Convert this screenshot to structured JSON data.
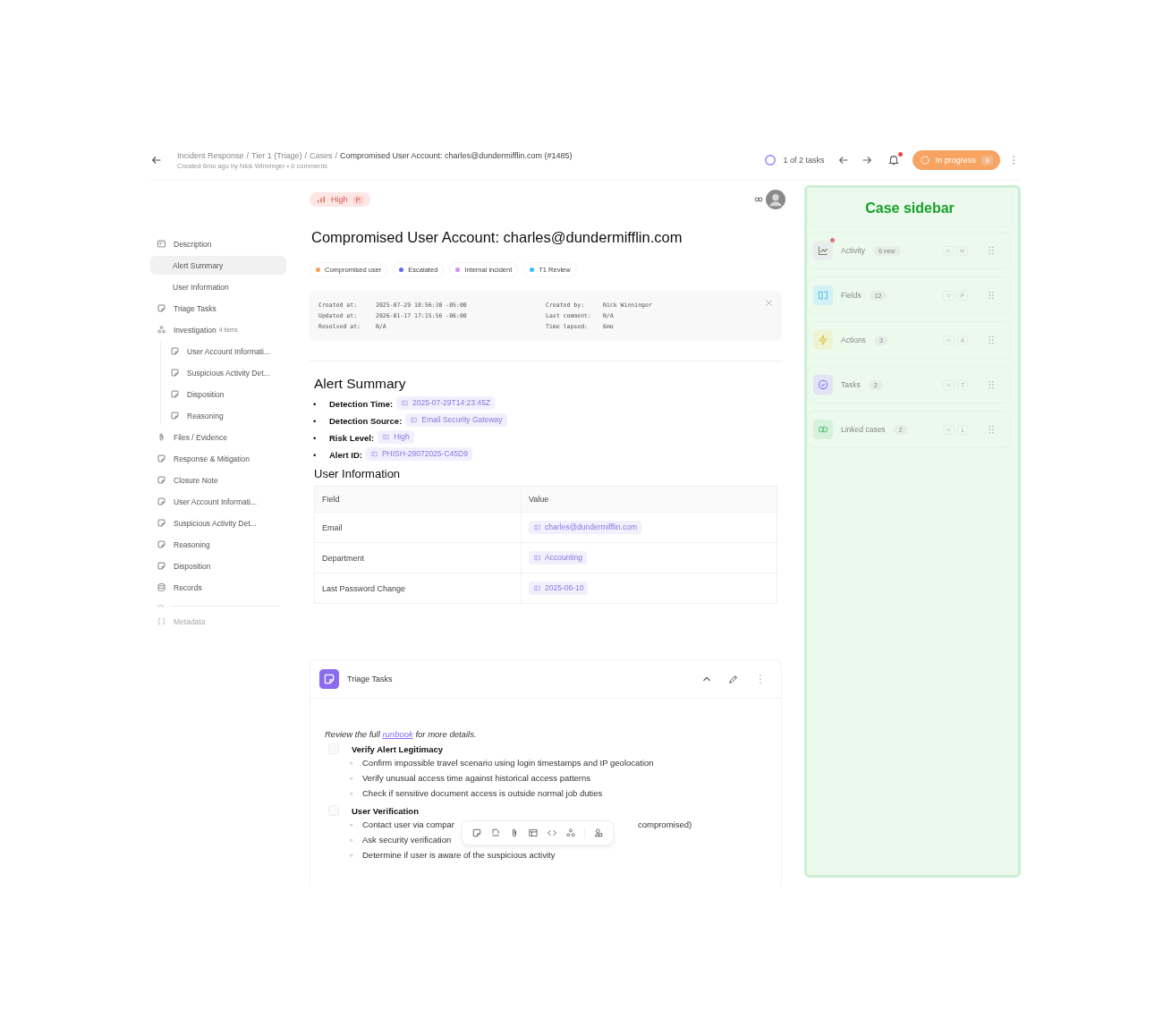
{
  "header": {
    "breadcrumb": [
      "Incident Response",
      "Tier 1 (Triage)",
      "Cases"
    ],
    "separator": "/",
    "title": "Compromised User Account: charles@dundermifflin.com (#1485)",
    "meta": "Created 6mo ago by Nick Winninger • 0 comments",
    "tasks": "1 of 2 tasks",
    "notification_dot": true,
    "status": {
      "label": "In progress",
      "key": "S"
    }
  },
  "nav": {
    "items": [
      {
        "label": "Description",
        "kind": "text",
        "children": [
          {
            "label": "Alert Summary",
            "selected": true
          },
          {
            "label": "User Information",
            "selected": false
          }
        ]
      },
      {
        "label": "Triage Tasks",
        "kind": "note",
        "selected": false
      },
      {
        "label": "Investigation",
        "count": "4 items",
        "kind": "group",
        "children": [
          {
            "label": "User Account Informati...",
            "kind": "note",
            "selected": false
          },
          {
            "label": "Suspicious Activity Det...",
            "kind": "note",
            "selected": false
          },
          {
            "label": "Disposition",
            "kind": "note",
            "selected": false
          },
          {
            "label": "Reasoning",
            "kind": "note",
            "selected": false
          }
        ]
      },
      {
        "label": "Files / Evidence",
        "kind": "clip",
        "selected": false
      },
      {
        "label": "Response & Mitigation",
        "kind": "note",
        "selected": false
      },
      {
        "label": "Closure Note",
        "kind": "note",
        "selected": false
      },
      {
        "label": "User Account Informati...",
        "kind": "note",
        "selected": false
      },
      {
        "label": "Suspicious Activity Det...",
        "kind": "note",
        "selected": false
      },
      {
        "label": "Reasoning",
        "kind": "note",
        "selected": false
      },
      {
        "label": "Disposition",
        "kind": "note",
        "selected": false
      },
      {
        "label": "Records",
        "kind": "db",
        "selected": false
      }
    ],
    "metadata": {
      "label": "Metadata",
      "disabled": true
    }
  },
  "case": {
    "priority": {
      "label": "High",
      "key": "P"
    },
    "title": "Compromised User Account: charles@dundermifflin.com",
    "tags": [
      {
        "label": "Compromised user",
        "color": "#f59e5b"
      },
      {
        "label": "Escalated",
        "color": "#6366f1"
      },
      {
        "label": "Internal incident",
        "color": "#d18cf0"
      },
      {
        "label": "T1 Review",
        "color": "#38bdf8"
      }
    ],
    "details_left": [
      {
        "label": "Created at:",
        "value": "2025-07-29 18:56:30 -05:00"
      },
      {
        "label": "Updated at:",
        "value": "2026-01-17 17:15:56 -06:00"
      },
      {
        "label": "Resolved at:",
        "value": "N/A"
      }
    ],
    "details_right": [
      {
        "label": "Created by:",
        "value": "Nick Winninger"
      },
      {
        "label": "Last comment:",
        "value": "N/A"
      },
      {
        "label": "Time lapsed:",
        "value": "6mo"
      }
    ]
  },
  "alert_summary": {
    "heading": "Alert Summary",
    "bullet": "•",
    "items": [
      {
        "label": "Detection Time:",
        "value": "2025-07-29T14:23:45Z"
      },
      {
        "label": "Detection Source:",
        "value": "Email Security Gateway"
      },
      {
        "label": "Risk Level:",
        "value": "High"
      },
      {
        "label": "Alert ID:",
        "value": "PHISH-29072025-C45D9"
      }
    ]
  },
  "user_information": {
    "heading": "User Information",
    "columns": [
      "Field",
      "Value"
    ],
    "rows": [
      [
        "Email",
        "charles@dundermifflin.com"
      ],
      [
        "Department",
        "Accounting"
      ],
      [
        "Last Password Change",
        "2025-06-10"
      ]
    ]
  },
  "triage_tasks": {
    "title": "Triage Tasks",
    "intro": {
      "before": "Review the full ",
      "link": "runbook",
      "after": " for more details."
    },
    "step_bullet": "◦",
    "tasks": [
      {
        "title": "Verify Alert Legitimacy",
        "checked": false,
        "steps": [
          [
            "Confirm impossible travel scenario using login timestamps and IP geolocation"
          ],
          [
            "Verify unusual access time against historical access patterns"
          ],
          [
            "Check if sensitive document access is outside normal job duties"
          ]
        ]
      },
      {
        "title": "User Verification",
        "checked": false,
        "steps": [
          [
            "Contact user via compar",
            "compromised)"
          ],
          [
            "Ask security verification"
          ],
          [
            "Determine if user is aware of the suspicious activity"
          ]
        ]
      }
    ]
  },
  "case_sidebar": {
    "title": "Case sidebar",
    "items": [
      {
        "label": "Activity",
        "badge": "6 new",
        "key": "H",
        "kind": "activity",
        "dot": true
      },
      {
        "label": "Fields",
        "badge": "12",
        "key": "F",
        "kind": "fields",
        "dot": false
      },
      {
        "label": "Actions",
        "badge": "3",
        "key": "A",
        "kind": "actions",
        "dot": false
      },
      {
        "label": "Tasks",
        "badge": "2",
        "key": "T",
        "kind": "tasks",
        "dot": false
      },
      {
        "label": "Linked cases",
        "badge": "2",
        "key": "L",
        "kind": "linked",
        "dot": false
      }
    ]
  }
}
